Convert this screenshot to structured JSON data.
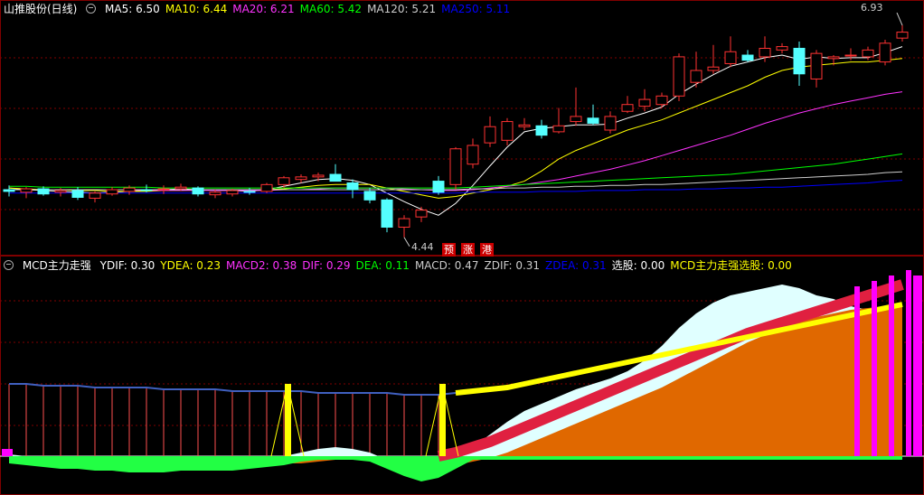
{
  "price_legend": {
    "title": "山推股份(日线)",
    "items": [
      {
        "label": "MA5: 6.50",
        "color": "#ffffff"
      },
      {
        "label": "MA10: 6.44",
        "color": "#ffff00"
      },
      {
        "label": "MA20: 6.21",
        "color": "#ff33ff"
      },
      {
        "label": "MA60: 5.42",
        "color": "#00ff00"
      },
      {
        "label": "MA120: 5.21",
        "color": "#cccccc"
      },
      {
        "label": "MA250: 5.11",
        "color": "#0000ff"
      }
    ]
  },
  "indicator_legend": {
    "title": "MCD主力走强",
    "items": [
      {
        "label": "YDIF: 0.30",
        "color": "#ffffff"
      },
      {
        "label": "YDEA: 0.23",
        "color": "#ffff00"
      },
      {
        "label": "MACD2: 0.38",
        "color": "#ff33ff"
      },
      {
        "label": "DIF: 0.29",
        "color": "#ff33ff"
      },
      {
        "label": "DEA: 0.11",
        "color": "#00ff00"
      },
      {
        "label": "MACD: 0.47",
        "color": "#cccccc"
      },
      {
        "label": "ZDIF: 0.31",
        "color": "#cccccc"
      },
      {
        "label": "ZDEA: 0.31",
        "color": "#0000ff"
      },
      {
        "label": "选股: 0.00",
        "color": "#ffffff"
      },
      {
        "label": "MCD主力走强选股: 0.00",
        "color": "#ffff00"
      }
    ]
  },
  "annotations": {
    "high_price": "6.93",
    "low_price": "4.44",
    "signals": [
      "预",
      "涨",
      "港"
    ]
  },
  "chart_data": {
    "type": "candlestick",
    "candles": [
      {
        "o": 5.0,
        "h": 5.05,
        "l": 4.92,
        "c": 4.98
      },
      {
        "o": 4.97,
        "h": 5.03,
        "l": 4.9,
        "c": 5.01
      },
      {
        "o": 5.01,
        "h": 5.04,
        "l": 4.93,
        "c": 4.95
      },
      {
        "o": 4.97,
        "h": 5.02,
        "l": 4.92,
        "c": 4.99
      },
      {
        "o": 4.99,
        "h": 5.03,
        "l": 4.88,
        "c": 4.91
      },
      {
        "o": 4.9,
        "h": 4.98,
        "l": 4.85,
        "c": 4.96
      },
      {
        "o": 4.95,
        "h": 5.03,
        "l": 4.93,
        "c": 5.0
      },
      {
        "o": 4.98,
        "h": 5.05,
        "l": 4.94,
        "c": 5.02
      },
      {
        "o": 5.0,
        "h": 5.06,
        "l": 4.97,
        "c": 4.99
      },
      {
        "o": 5.0,
        "h": 5.05,
        "l": 4.95,
        "c": 5.01
      },
      {
        "o": 5.01,
        "h": 5.07,
        "l": 4.99,
        "c": 5.03
      },
      {
        "o": 5.02,
        "h": 5.04,
        "l": 4.92,
        "c": 4.95
      },
      {
        "o": 4.94,
        "h": 5.0,
        "l": 4.9,
        "c": 4.97
      },
      {
        "o": 4.95,
        "h": 5.01,
        "l": 4.92,
        "c": 4.99
      },
      {
        "o": 4.98,
        "h": 5.02,
        "l": 4.94,
        "c": 4.97
      },
      {
        "o": 4.98,
        "h": 5.08,
        "l": 4.96,
        "c": 5.06
      },
      {
        "o": 5.06,
        "h": 5.16,
        "l": 5.02,
        "c": 5.14
      },
      {
        "o": 5.12,
        "h": 5.18,
        "l": 5.08,
        "c": 5.15
      },
      {
        "o": 5.15,
        "h": 5.2,
        "l": 5.1,
        "c": 5.17
      },
      {
        "o": 5.18,
        "h": 5.3,
        "l": 5.12,
        "c": 5.1
      },
      {
        "o": 5.08,
        "h": 5.12,
        "l": 4.9,
        "c": 5.0
      },
      {
        "o": 4.98,
        "h": 5.02,
        "l": 4.84,
        "c": 4.88
      },
      {
        "o": 4.88,
        "h": 4.9,
        "l": 4.5,
        "c": 4.56
      },
      {
        "o": 4.56,
        "h": 4.7,
        "l": 4.44,
        "c": 4.66
      },
      {
        "o": 4.68,
        "h": 4.8,
        "l": 4.62,
        "c": 4.76
      },
      {
        "o": 5.1,
        "h": 5.16,
        "l": 4.94,
        "c": 4.97
      },
      {
        "o": 5.06,
        "h": 5.5,
        "l": 5.0,
        "c": 5.48
      },
      {
        "o": 5.3,
        "h": 5.6,
        "l": 5.25,
        "c": 5.52
      },
      {
        "o": 5.55,
        "h": 5.86,
        "l": 5.5,
        "c": 5.74
      },
      {
        "o": 5.58,
        "h": 5.84,
        "l": 5.52,
        "c": 5.8
      },
      {
        "o": 5.74,
        "h": 5.84,
        "l": 5.7,
        "c": 5.76
      },
      {
        "o": 5.75,
        "h": 5.82,
        "l": 5.6,
        "c": 5.64
      },
      {
        "o": 5.68,
        "h": 5.96,
        "l": 5.66,
        "c": 5.75
      },
      {
        "o": 5.8,
        "h": 6.2,
        "l": 5.75,
        "c": 5.86
      },
      {
        "o": 5.84,
        "h": 6.0,
        "l": 5.76,
        "c": 5.78
      },
      {
        "o": 5.7,
        "h": 5.92,
        "l": 5.66,
        "c": 5.86
      },
      {
        "o": 5.92,
        "h": 6.1,
        "l": 5.9,
        "c": 6.0
      },
      {
        "o": 5.98,
        "h": 6.18,
        "l": 5.92,
        "c": 6.06
      },
      {
        "o": 6.0,
        "h": 6.14,
        "l": 5.96,
        "c": 6.1
      },
      {
        "o": 6.1,
        "h": 6.6,
        "l": 6.04,
        "c": 6.56
      },
      {
        "o": 6.26,
        "h": 6.62,
        "l": 6.2,
        "c": 6.4
      },
      {
        "o": 6.4,
        "h": 6.7,
        "l": 6.36,
        "c": 6.44
      },
      {
        "o": 6.48,
        "h": 6.8,
        "l": 6.44,
        "c": 6.62
      },
      {
        "o": 6.58,
        "h": 6.64,
        "l": 6.5,
        "c": 6.52
      },
      {
        "o": 6.56,
        "h": 6.8,
        "l": 6.5,
        "c": 6.66
      },
      {
        "o": 6.64,
        "h": 6.72,
        "l": 6.6,
        "c": 6.68
      },
      {
        "o": 6.66,
        "h": 6.74,
        "l": 6.22,
        "c": 6.36
      },
      {
        "o": 6.3,
        "h": 6.64,
        "l": 6.2,
        "c": 6.6
      },
      {
        "o": 6.54,
        "h": 6.58,
        "l": 6.46,
        "c": 6.56
      },
      {
        "o": 6.58,
        "h": 6.66,
        "l": 6.52,
        "c": 6.58
      },
      {
        "o": 6.56,
        "h": 6.68,
        "l": 6.52,
        "c": 6.64
      },
      {
        "o": 6.5,
        "h": 6.76,
        "l": 6.46,
        "c": 6.72
      },
      {
        "o": 6.78,
        "h": 6.93,
        "l": 6.74,
        "c": 6.85
      }
    ],
    "ma": [
      {
        "name": "MA5",
        "color": "#ffffff",
        "values": [
          5.02,
          5.0,
          4.99,
          4.98,
          4.97,
          4.96,
          4.97,
          4.98,
          4.99,
          5.0,
          5.01,
          5.0,
          4.99,
          4.99,
          4.98,
          5.0,
          5.04,
          5.08,
          5.12,
          5.13,
          5.11,
          5.06,
          4.96,
          4.86,
          4.77,
          4.7,
          4.84,
          5.05,
          5.28,
          5.5,
          5.68,
          5.72,
          5.74,
          5.76,
          5.76,
          5.77,
          5.84,
          5.9,
          5.97,
          6.12,
          6.24,
          6.35,
          6.45,
          6.5,
          6.55,
          6.58,
          6.53,
          6.56,
          6.54,
          6.55,
          6.55,
          6.61,
          6.68
        ]
      },
      {
        "name": "MA10",
        "color": "#ffff00",
        "values": [
          5.02,
          5.01,
          5.0,
          5.0,
          4.99,
          4.99,
          4.98,
          4.98,
          4.98,
          4.99,
          4.99,
          5.0,
          5.0,
          5.0,
          4.99,
          5.0,
          5.01,
          5.03,
          5.05,
          5.06,
          5.06,
          5.06,
          5.02,
          4.98,
          4.94,
          4.9,
          4.92,
          4.96,
          5.0,
          5.04,
          5.1,
          5.22,
          5.36,
          5.46,
          5.54,
          5.62,
          5.7,
          5.76,
          5.82,
          5.9,
          5.98,
          6.06,
          6.14,
          6.22,
          6.32,
          6.4,
          6.44,
          6.46,
          6.48,
          6.5,
          6.5,
          6.52,
          6.54
        ]
      },
      {
        "name": "MA20",
        "color": "#ff33ff",
        "values": [
          5.0,
          5.0,
          5.0,
          5.0,
          5.0,
          5.0,
          5.0,
          5.0,
          4.99,
          4.99,
          4.99,
          4.99,
          4.99,
          4.99,
          4.99,
          4.99,
          5.0,
          5.0,
          5.01,
          5.02,
          5.02,
          5.02,
          5.02,
          5.01,
          5.0,
          4.99,
          4.99,
          5.0,
          5.02,
          5.04,
          5.06,
          5.09,
          5.12,
          5.16,
          5.2,
          5.24,
          5.29,
          5.34,
          5.4,
          5.46,
          5.52,
          5.58,
          5.64,
          5.71,
          5.78,
          5.84,
          5.9,
          5.95,
          6.0,
          6.04,
          6.08,
          6.12,
          6.15
        ]
      },
      {
        "name": "MA60",
        "color": "#00ff00",
        "values": [
          5.04,
          5.04,
          5.03,
          5.03,
          5.03,
          5.03,
          5.03,
          5.03,
          5.03,
          5.02,
          5.02,
          5.02,
          5.02,
          5.02,
          5.02,
          5.02,
          5.02,
          5.02,
          5.02,
          5.02,
          5.02,
          5.02,
          5.02,
          5.02,
          5.02,
          5.02,
          5.02,
          5.03,
          5.04,
          5.05,
          5.06,
          5.07,
          5.08,
          5.09,
          5.1,
          5.11,
          5.12,
          5.13,
          5.14,
          5.15,
          5.16,
          5.17,
          5.18,
          5.2,
          5.22,
          5.24,
          5.26,
          5.28,
          5.3,
          5.33,
          5.36,
          5.39,
          5.42
        ]
      },
      {
        "name": "MA120",
        "color": "#cccccc",
        "values": [
          5.0,
          5.0,
          5.0,
          5.0,
          5.0,
          5.0,
          5.0,
          5.0,
          5.0,
          5.0,
          5.0,
          5.0,
          5.0,
          5.0,
          5.0,
          5.0,
          5.0,
          5.0,
          5.0,
          5.0,
          5.0,
          5.0,
          5.0,
          5.0,
          5.0,
          5.0,
          5.0,
          5.01,
          5.01,
          5.02,
          5.02,
          5.03,
          5.03,
          5.04,
          5.04,
          5.05,
          5.05,
          5.06,
          5.06,
          5.07,
          5.08,
          5.09,
          5.1,
          5.11,
          5.12,
          5.13,
          5.14,
          5.15,
          5.16,
          5.17,
          5.18,
          5.2,
          5.21
        ]
      },
      {
        "name": "MA250",
        "color": "#0000ff",
        "values": [
          4.96,
          4.96,
          4.96,
          4.96,
          4.96,
          4.96,
          4.96,
          4.96,
          4.96,
          4.96,
          4.96,
          4.96,
          4.96,
          4.96,
          4.96,
          4.96,
          4.96,
          4.96,
          4.96,
          4.96,
          4.96,
          4.96,
          4.96,
          4.96,
          4.96,
          4.96,
          4.96,
          4.97,
          4.97,
          4.97,
          4.97,
          4.98,
          4.98,
          4.98,
          4.99,
          4.99,
          4.99,
          5.0,
          5.0,
          5.0,
          5.01,
          5.01,
          5.02,
          5.02,
          5.03,
          5.03,
          5.04,
          5.05,
          5.06,
          5.07,
          5.08,
          5.1,
          5.11
        ]
      }
    ],
    "indicator": {
      "dif": [
        -0.02,
        -0.03,
        -0.04,
        -0.05,
        -0.05,
        -0.06,
        -0.06,
        -0.07,
        -0.07,
        -0.07,
        -0.06,
        -0.06,
        -0.06,
        -0.06,
        -0.05,
        -0.04,
        -0.03,
        -0.01,
        0.01,
        0.02,
        0.01,
        -0.01,
        -0.05,
        -0.09,
        -0.12,
        -0.1,
        -0.05,
        0.02,
        0.09,
        0.16,
        0.22,
        0.26,
        0.3,
        0.34,
        0.37,
        0.4,
        0.44,
        0.5,
        0.58,
        0.68,
        0.76,
        0.82,
        0.86,
        0.88,
        0.9,
        0.92,
        0.9,
        0.86,
        0.84,
        0.8,
        0.78,
        0.76,
        0.75
      ],
      "dea": [
        0.0,
        -0.01,
        -0.01,
        -0.02,
        -0.03,
        -0.03,
        -0.04,
        -0.04,
        -0.05,
        -0.05,
        -0.05,
        -0.05,
        -0.05,
        -0.05,
        -0.05,
        -0.05,
        -0.04,
        -0.04,
        -0.03,
        -0.02,
        -0.01,
        -0.01,
        -0.02,
        -0.03,
        -0.05,
        -0.06,
        -0.05,
        -0.03,
        -0.01,
        0.02,
        0.06,
        0.1,
        0.14,
        0.18,
        0.22,
        0.26,
        0.3,
        0.34,
        0.38,
        0.43,
        0.48,
        0.53,
        0.58,
        0.63,
        0.67,
        0.71,
        0.74,
        0.77,
        0.79,
        0.81,
        0.82,
        0.83,
        0.84
      ],
      "macd2": [
        0.0,
        0.0,
        0.0,
        0.0,
        0.0,
        0.0,
        0.0,
        0.0,
        0.0,
        0.0,
        0.0,
        0.0,
        0.0,
        0.0,
        0.0,
        0.0,
        0.0,
        0.0,
        0.0,
        0.0,
        0.0,
        0.0,
        0.0,
        0.0,
        0.0,
        0.0,
        0.02,
        0.05,
        0.08,
        0.12,
        0.16,
        0.2,
        0.24,
        0.28,
        0.32,
        0.36,
        0.4,
        0.44,
        0.48,
        0.52,
        0.56,
        0.6,
        0.64,
        0.68,
        0.71,
        0.74,
        0.77,
        0.8,
        0.83,
        0.86,
        0.89,
        0.92,
        0.95
      ],
      "ydea": [
        0.4,
        0.4,
        0.39,
        0.39,
        0.39,
        0.38,
        0.38,
        0.38,
        0.38,
        0.37,
        0.37,
        0.37,
        0.37,
        0.36,
        0.36,
        0.36,
        0.36,
        0.36,
        0.35,
        0.35,
        0.35,
        0.35,
        0.35,
        0.34,
        0.34,
        0.34,
        0.35,
        0.36,
        0.37,
        0.38,
        0.4,
        0.42,
        0.44,
        0.46,
        0.48,
        0.5,
        0.52,
        0.54,
        0.56,
        0.58,
        0.6,
        0.62,
        0.64,
        0.66,
        0.68,
        0.7,
        0.72,
        0.74,
        0.76,
        0.78,
        0.8,
        0.82,
        0.84
      ],
      "signal_bars": [
        16,
        25
      ]
    }
  }
}
